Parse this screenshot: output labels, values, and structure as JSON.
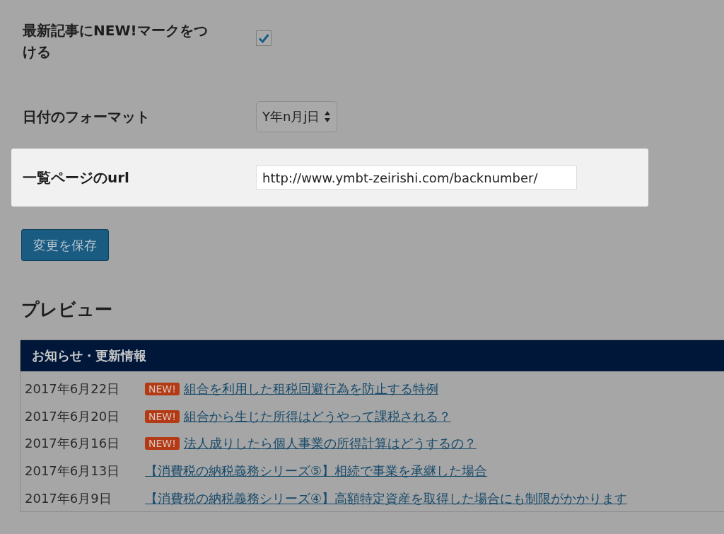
{
  "settings": [
    {
      "kind": "checkbox",
      "label": "最新記事にNEW!マークをつける",
      "checked": true,
      "highlighted": false
    },
    {
      "kind": "select",
      "label": "日付のフォーマット",
      "value": "Y年n月j日",
      "highlighted": false
    },
    {
      "kind": "text",
      "label": "一覧ページのurl",
      "value": "http://www.ymbt-zeirishi.com/backnumber/",
      "highlighted": true
    }
  ],
  "save_button": "変更を保存",
  "preview": {
    "heading": "プレビュー",
    "widget_title": "お知らせ・更新情報",
    "posts": [
      {
        "date": "2017年6月22日",
        "new": true,
        "badge": "NEW!",
        "title": "組合を利用した租税回避行為を防止する特例"
      },
      {
        "date": "2017年6月20日",
        "new": true,
        "badge": "NEW!",
        "title": "組合から生じた所得はどうやって課税される？"
      },
      {
        "date": "2017年6月16日",
        "new": true,
        "badge": "NEW!",
        "title": "法人成りしたら個人事業の所得計算はどうするの？"
      },
      {
        "date": "2017年6月13日",
        "new": false,
        "title": "【消費税の納税義務シリーズ⑤】相続で事業を承継した場合"
      },
      {
        "date": "2017年6月9日",
        "new": false,
        "title": "【消費税の納税義務シリーズ④】高額特定資産を取得した場合にも制限がかかります"
      }
    ]
  }
}
